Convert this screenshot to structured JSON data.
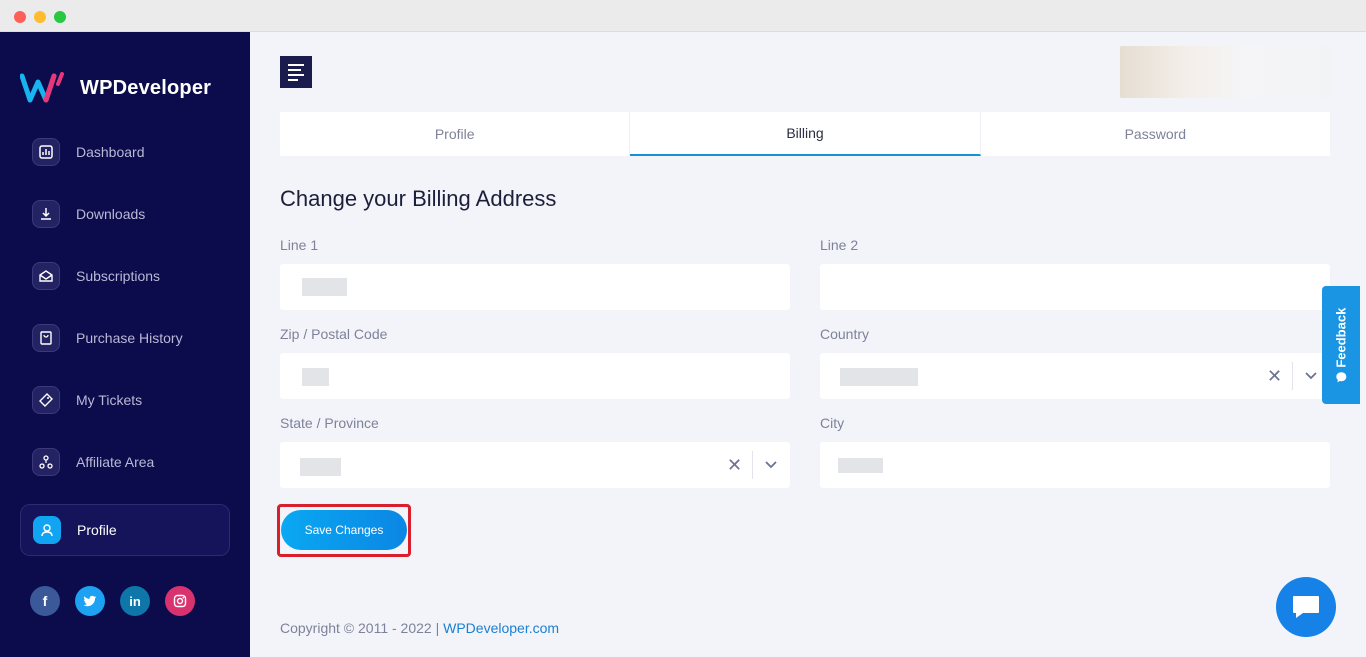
{
  "brand": {
    "name": "WPDeveloper"
  },
  "sidebar": {
    "items": [
      {
        "label": "Dashboard",
        "icon": "chart-icon"
      },
      {
        "label": "Downloads",
        "icon": "download-icon"
      },
      {
        "label": "Subscriptions",
        "icon": "subscription-icon"
      },
      {
        "label": "Purchase History",
        "icon": "receipt-icon"
      },
      {
        "label": "My Tickets",
        "icon": "ticket-icon"
      },
      {
        "label": "Affiliate Area",
        "icon": "affiliate-icon"
      },
      {
        "label": "Profile",
        "icon": "user-icon",
        "active": true
      }
    ],
    "social": [
      "facebook-icon",
      "twitter-icon",
      "linkedin-icon",
      "instagram-icon"
    ]
  },
  "tabs": [
    {
      "label": "Profile"
    },
    {
      "label": "Billing",
      "active": true
    },
    {
      "label": "Password"
    }
  ],
  "form": {
    "title": "Change your Billing Address",
    "line1_label": "Line 1",
    "line2_label": "Line 2",
    "zip_label": "Zip / Postal Code",
    "country_label": "Country",
    "state_label": "State / Province",
    "city_label": "City",
    "save_label": "Save Changes"
  },
  "feedback": {
    "label": "Feedback"
  },
  "footer": {
    "copyright": "Copyright © 2011 - 2022 |",
    "link": "WPDeveloper.com"
  },
  "colors": {
    "sidebar": "#0c0b4c",
    "accent": "#10a4f2",
    "highlight": "#d81f2b"
  }
}
